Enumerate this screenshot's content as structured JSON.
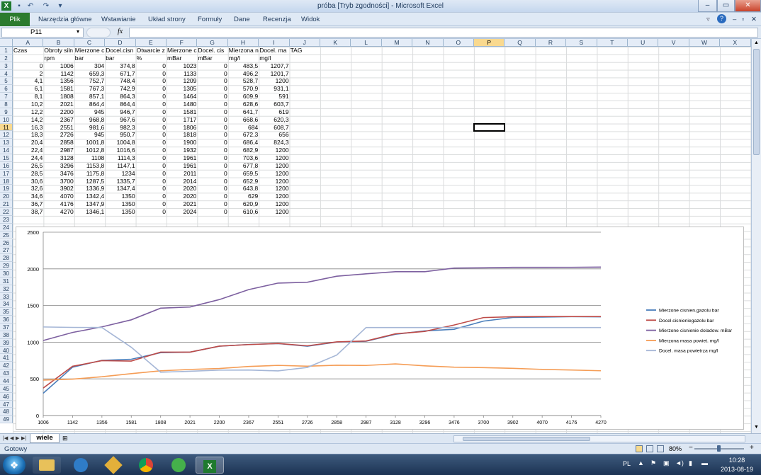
{
  "window": {
    "title": "próba  [Tryb zgodności] - Microsoft Excel",
    "controls": {
      "minimize": "–",
      "maximize": "▭",
      "close": "✕"
    }
  },
  "ribbon": {
    "file_tab": "Plik",
    "tabs": [
      "Narzędzia główne",
      "Wstawianie",
      "Układ strony",
      "Formuły",
      "Dane",
      "Recenzja",
      "Widok"
    ]
  },
  "formula_bar": {
    "name_box": "P11",
    "fx_label": "fx",
    "formula": ""
  },
  "columns": [
    "A",
    "B",
    "C",
    "D",
    "E",
    "F",
    "G",
    "H",
    "I",
    "J",
    "K",
    "L",
    "M",
    "N",
    "O",
    "P",
    "Q",
    "R",
    "S",
    "T",
    "U",
    "V",
    "W",
    "X"
  ],
  "selected_column": "P",
  "selected_row": "11",
  "rows": [
    "1",
    "2",
    "3",
    "4",
    "5",
    "6",
    "7",
    "8",
    "9",
    "10",
    "11",
    "12",
    "13",
    "14",
    "15",
    "16",
    "17",
    "18",
    "19",
    "20",
    "21",
    "22",
    "23",
    "24",
    "25",
    "26",
    "27",
    "28",
    "29",
    "30",
    "31",
    "32",
    "33",
    "34",
    "35",
    "36",
    "37",
    "38",
    "39",
    "40",
    "41",
    "42",
    "43",
    "44",
    "45",
    "46",
    "47",
    "48",
    "49"
  ],
  "table": {
    "headers": [
      "Czas",
      "Obroty siln",
      "Mierzone c",
      "Docel.cisn",
      "Otwarcie z",
      "Mierzone c",
      "Docel. cis",
      "Mierzona n",
      "Docel. ma",
      "TAG"
    ],
    "units": [
      "",
      "rpm",
      "bar",
      "bar",
      "%",
      "mBar",
      "mBar",
      "mg/l",
      "mg/l",
      ""
    ],
    "data": [
      [
        "0",
        "1006",
        "304",
        "374,8",
        "0",
        "1023",
        "0",
        "483,5",
        "1207,7"
      ],
      [
        "2",
        "1142",
        "659,3",
        "671,7",
        "0",
        "1133",
        "0",
        "496,2",
        "1201,7"
      ],
      [
        "4,1",
        "1356",
        "752,7",
        "748,4",
        "0",
        "1209",
        "0",
        "528,7",
        "1200"
      ],
      [
        "6,1",
        "1581",
        "767,3",
        "742,9",
        "0",
        "1305",
        "0",
        "570,9",
        "931,1"
      ],
      [
        "8,1",
        "1808",
        "857,1",
        "864,3",
        "0",
        "1464",
        "0",
        "609,9",
        "591"
      ],
      [
        "10,2",
        "2021",
        "864,4",
        "864,4",
        "0",
        "1480",
        "0",
        "628,6",
        "603,7"
      ],
      [
        "12,2",
        "2200",
        "945",
        "946,7",
        "0",
        "1581",
        "0",
        "641,7",
        "619"
      ],
      [
        "14,2",
        "2367",
        "968,8",
        "967,6",
        "0",
        "1717",
        "0",
        "668,6",
        "620,3"
      ],
      [
        "16,3",
        "2551",
        "981,6",
        "982,3",
        "0",
        "1806",
        "0",
        "684",
        "608,7"
      ],
      [
        "18,3",
        "2726",
        "945",
        "950,7",
        "0",
        "1818",
        "0",
        "672,3",
        "656"
      ],
      [
        "20,4",
        "2858",
        "1001,8",
        "1004,8",
        "0",
        "1900",
        "0",
        "686,4",
        "824,3"
      ],
      [
        "22,4",
        "2987",
        "1012,8",
        "1016,6",
        "0",
        "1932",
        "0",
        "682,9",
        "1200"
      ],
      [
        "24,4",
        "3128",
        "1108",
        "1114,3",
        "0",
        "1961",
        "0",
        "703,6",
        "1200"
      ],
      [
        "26,5",
        "3296",
        "1153,8",
        "1147,1",
        "0",
        "1961",
        "0",
        "677,8",
        "1200"
      ],
      [
        "28,5",
        "3476",
        "1175,8",
        "1234",
        "0",
        "2011",
        "0",
        "659,5",
        "1200"
      ],
      [
        "30,6",
        "3700",
        "1287,5",
        "1335,7",
        "0",
        "2014",
        "0",
        "652,9",
        "1200"
      ],
      [
        "32,6",
        "3902",
        "1336,9",
        "1347,4",
        "0",
        "2020",
        "0",
        "643,8",
        "1200"
      ],
      [
        "34,6",
        "4070",
        "1342,4",
        "1350",
        "0",
        "2020",
        "0",
        "629",
        "1200"
      ],
      [
        "36,7",
        "4176",
        "1347,9",
        "1350",
        "0",
        "2021",
        "0",
        "620,9",
        "1200"
      ],
      [
        "38,7",
        "4270",
        "1346,1",
        "1350",
        "0",
        "2024",
        "0",
        "610,6",
        "1200"
      ]
    ]
  },
  "chart_data": {
    "type": "line",
    "categories": [
      "1006",
      "1142",
      "1356",
      "1581",
      "1808",
      "2021",
      "2200",
      "2367",
      "2551",
      "2726",
      "2858",
      "2987",
      "3128",
      "3296",
      "3476",
      "3700",
      "3902",
      "4070",
      "4176",
      "4270"
    ],
    "ylim": [
      0,
      2500
    ],
    "yticks": [
      "0",
      "500",
      "1000",
      "1500",
      "2000",
      "2500"
    ],
    "grid": true,
    "legend_position": "right",
    "series": [
      {
        "name": "Mierzone cisnien.gazolu bar",
        "color": "#4a7ebb",
        "values": [
          304,
          659.3,
          752.7,
          767.3,
          857.1,
          864.4,
          945,
          968.8,
          981.6,
          945,
          1001.8,
          1012.8,
          1108,
          1153.8,
          1175.8,
          1287.5,
          1336.9,
          1342.4,
          1347.9,
          1346.1
        ]
      },
      {
        "name": "Docel.cisnieniegazolu bar",
        "color": "#be4b48",
        "values": [
          374.8,
          671.7,
          748.4,
          742.9,
          864.3,
          864.4,
          946.7,
          967.6,
          982.3,
          950.7,
          1004.8,
          1016.6,
          1114.3,
          1147.1,
          1234,
          1335.7,
          1347.4,
          1350,
          1350,
          1350
        ]
      },
      {
        "name": "Mierzone cisnienie doladow. mBar",
        "color": "#7d60a0",
        "values": [
          1023,
          1133,
          1209,
          1305,
          1464,
          1480,
          1581,
          1717,
          1806,
          1818,
          1900,
          1932,
          1961,
          1961,
          2011,
          2014,
          2020,
          2020,
          2021,
          2024
        ]
      },
      {
        "name": "Mierzona masa powiet. mg/l",
        "color": "#f59d56",
        "values": [
          483.5,
          496.2,
          528.7,
          570.9,
          609.9,
          628.6,
          641.7,
          668.6,
          684,
          672.3,
          686.4,
          682.9,
          703.6,
          677.8,
          659.5,
          652.9,
          643.8,
          629,
          620.9,
          610.6
        ]
      },
      {
        "name": "Docel. masa powietrza mg/l",
        "color": "#a5b6d6",
        "values": [
          1207.7,
          1201.7,
          1200,
          931.1,
          591,
          603.7,
          619,
          620.3,
          608.7,
          656,
          824.3,
          1200,
          1200,
          1200,
          1200,
          1200,
          1200,
          1200,
          1200,
          1200
        ]
      }
    ]
  },
  "sheet_tabs": {
    "active": "wiele"
  },
  "status": {
    "ready": "Gotowy",
    "zoom": "80%"
  },
  "taskbar": {
    "language": "PL",
    "time": "10:28",
    "date": "2013-08-19"
  }
}
